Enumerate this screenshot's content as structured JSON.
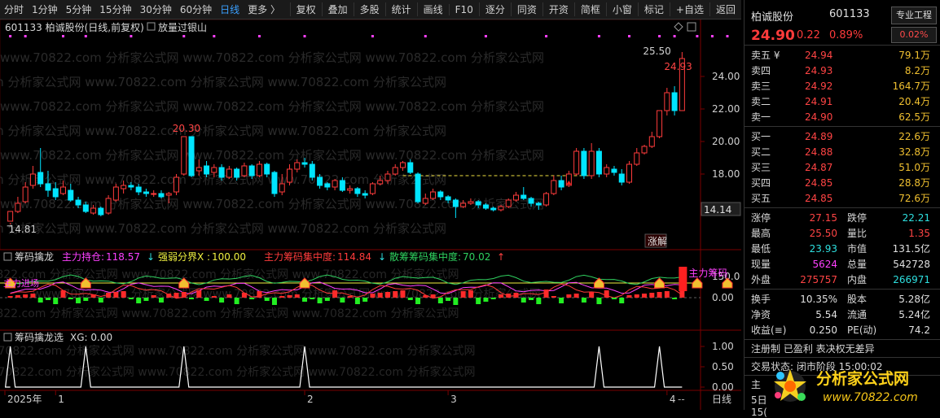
{
  "toolbar": {
    "left_items": [
      "分时",
      "1分钟",
      "5分钟",
      "15分钟",
      "30分钟",
      "60分钟",
      "日线",
      "更多 〉"
    ],
    "active": "日线",
    "right_items": [
      "复权",
      "叠加",
      "多股",
      "统计",
      "画线",
      "F10",
      "逐分",
      "同资",
      "开资",
      "简框",
      "小窗",
      "标记",
      "+自选",
      "返回"
    ]
  },
  "main_chart": {
    "title": "601133 柏诚股份(日线,前复权)",
    "indicator_label": "放量过银山",
    "watermark": "www.70822.com 分析家公式网",
    "y_axis": [
      "24.00",
      "22.00",
      "20.00",
      "18.00",
      "16.00"
    ],
    "y_ticks": [
      24,
      22,
      20,
      18,
      16
    ],
    "y_range": [
      13.6,
      26.4
    ],
    "annot_high": "20.30",
    "annot_low": "14.81",
    "annot_peak": "25.50",
    "annot_last": "24.93",
    "cursor_value": "14.14",
    "badge": "涨解",
    "up_color": "#ff3b3b",
    "down_color": "#00e5ff",
    "dashed_level": 17.9
  },
  "chart_data": [
    {
      "type": "candlestick",
      "title": "601133 柏诚股份(日线,前复权)",
      "candles": [
        [
          15.1,
          15.7,
          15.0,
          14.9
        ],
        [
          15.7,
          16.2,
          16.6,
          15.6
        ],
        [
          16.3,
          17.2,
          17.5,
          16.2
        ],
        [
          17.3,
          18.0,
          18.5,
          17.1
        ],
        [
          18.1,
          17.4,
          19.6,
          17.2
        ],
        [
          17.4,
          17.0,
          18.2,
          16.6
        ],
        [
          17.1,
          16.6,
          17.5,
          16.4
        ],
        [
          16.8,
          17.2,
          17.6,
          16.7
        ],
        [
          17.0,
          16.4,
          17.4,
          16.3
        ],
        [
          16.4,
          16.1,
          16.6,
          15.9
        ],
        [
          16.1,
          15.7,
          16.3,
          15.6
        ],
        [
          15.6,
          15.9,
          16.1,
          15.5
        ],
        [
          15.9,
          15.5,
          16.0,
          15.4
        ],
        [
          15.6,
          16.5,
          16.7,
          15.5
        ],
        [
          16.4,
          17.2,
          17.4,
          16.3
        ],
        [
          17.1,
          17.3,
          17.6,
          16.8
        ],
        [
          17.3,
          17.2,
          17.5,
          17.0
        ],
        [
          17.2,
          16.9,
          17.4,
          16.7
        ],
        [
          16.9,
          16.8,
          17.1,
          16.6
        ],
        [
          16.8,
          16.8,
          17.0,
          16.6
        ],
        [
          16.8,
          16.6,
          17.0,
          16.5
        ],
        [
          16.7,
          16.8,
          16.9,
          16.2
        ],
        [
          16.9,
          17.8,
          18.0,
          16.7
        ],
        [
          18.0,
          20.3,
          20.3,
          17.9
        ],
        [
          20.3,
          17.9,
          20.3,
          17.8
        ],
        [
          18.2,
          18.4,
          18.9,
          17.9
        ],
        [
          18.5,
          18.0,
          18.8,
          17.8
        ],
        [
          18.1,
          18.4,
          18.6,
          17.8
        ],
        [
          18.4,
          17.8,
          18.6,
          17.6
        ],
        [
          17.8,
          18.3,
          18.5,
          17.7
        ],
        [
          18.3,
          17.8,
          18.4,
          17.6
        ],
        [
          17.9,
          18.5,
          18.7,
          17.8
        ],
        [
          18.5,
          17.9,
          18.6,
          17.7
        ],
        [
          17.9,
          18.6,
          18.8,
          17.8
        ],
        [
          18.6,
          18.0,
          18.7,
          17.8
        ],
        [
          18.1,
          16.8,
          18.2,
          16.6
        ],
        [
          16.9,
          17.4,
          18.0,
          16.7
        ],
        [
          17.5,
          18.3,
          18.6,
          17.3
        ],
        [
          18.3,
          18.7,
          18.9,
          18.1
        ],
        [
          18.7,
          18.6,
          19.0,
          18.4
        ],
        [
          18.6,
          17.8,
          18.8,
          17.6
        ],
        [
          17.8,
          17.3,
          18.0,
          17.1
        ],
        [
          17.4,
          17.2,
          17.5,
          17.0
        ],
        [
          17.2,
          17.6,
          17.7,
          17.0
        ],
        [
          17.6,
          17.0,
          17.8,
          16.9
        ],
        [
          17.0,
          17.1,
          17.3,
          16.8
        ],
        [
          17.1,
          16.8,
          17.2,
          16.6
        ],
        [
          16.8,
          16.7,
          17.0,
          16.5
        ],
        [
          16.8,
          17.4,
          17.5,
          16.7
        ],
        [
          17.4,
          17.6,
          17.9,
          17.3
        ],
        [
          17.6,
          18.0,
          18.2,
          17.4
        ],
        [
          18.0,
          18.4,
          18.6,
          17.9
        ],
        [
          18.4,
          18.7,
          18.8,
          18.2
        ],
        [
          18.7,
          18.1,
          18.9,
          18.0
        ],
        [
          18.0,
          16.3,
          18.1,
          16.2
        ],
        [
          16.2,
          16.5,
          16.8,
          16.1
        ],
        [
          16.5,
          16.9,
          17.1,
          16.4
        ],
        [
          16.9,
          16.6,
          17.0,
          16.4
        ],
        [
          16.6,
          16.4,
          16.7,
          16.2
        ],
        [
          16.4,
          16.0,
          16.5,
          15.3
        ],
        [
          16.0,
          16.2,
          16.4,
          15.9
        ],
        [
          16.2,
          16.3,
          16.5,
          16.1
        ],
        [
          16.3,
          16.1,
          16.4,
          15.9
        ],
        [
          16.1,
          15.9,
          16.2,
          15.8
        ],
        [
          15.9,
          15.8,
          16.0,
          15.7
        ],
        [
          15.8,
          16.0,
          16.1,
          15.7
        ],
        [
          16.0,
          16.4,
          16.5,
          15.9
        ],
        [
          16.4,
          16.7,
          16.9,
          16.3
        ],
        [
          16.7,
          16.5,
          17.2,
          16.4
        ],
        [
          16.5,
          16.2,
          16.6,
          16.0
        ],
        [
          16.2,
          16.1,
          16.3,
          15.8
        ],
        [
          16.1,
          16.8,
          16.9,
          16.0
        ],
        [
          16.8,
          17.6,
          17.9,
          16.7
        ],
        [
          17.6,
          17.2,
          17.9,
          17.0
        ],
        [
          17.3,
          18.0,
          18.2,
          17.2
        ],
        [
          18.0,
          19.4,
          19.6,
          17.9
        ],
        [
          19.4,
          17.9,
          19.6,
          17.7
        ],
        [
          17.9,
          19.4,
          19.9,
          17.7
        ],
        [
          19.4,
          18.0,
          19.6,
          17.8
        ],
        [
          18.0,
          18.4,
          18.6,
          17.8
        ],
        [
          18.3,
          18.1,
          18.5,
          17.9
        ],
        [
          18.0,
          17.5,
          18.3,
          17.3
        ],
        [
          17.5,
          18.6,
          18.8,
          17.4
        ],
        [
          18.6,
          19.3,
          19.6,
          18.5
        ],
        [
          19.3,
          19.7,
          19.8,
          19.2
        ],
        [
          19.7,
          20.3,
          20.6,
          19.6
        ],
        [
          20.3,
          21.9,
          21.9,
          20.2
        ],
        [
          21.9,
          23.0,
          23.3,
          21.6
        ],
        [
          23.0,
          21.9,
          23.4,
          21.6
        ],
        [
          21.9,
          25.1,
          25.5,
          21.9
        ]
      ],
      "y_ticks": [
        24,
        22,
        20,
        18,
        16
      ]
    },
    {
      "type": "composite",
      "title": "筹码擒龙",
      "legend": [
        {
          "name": "主力持仓",
          "value": "118.57",
          "arrow": "↓",
          "color": "#ff40ff"
        },
        {
          "name": "强弱分界X",
          "value": "100.00",
          "arrow": "",
          "color": "#f0f040"
        },
        {
          "name": "主力筹码集中度",
          "value": "114.84",
          "arrow": "↓",
          "color": "#ff3b3b"
        },
        {
          "name": "散筹筹码集中度",
          "value": "70.02",
          "arrow": "↑",
          "color": "#2fd05f"
        }
      ],
      "y_axis": [
        "150.0",
        "0.00"
      ],
      "label_right": "主力筹码",
      "label_left": "主力进场"
    },
    {
      "type": "line",
      "title": "筹码擒龙选",
      "legend": "XG: 0.00",
      "y_axis": [
        "1.00",
        "0.50",
        "0.00"
      ],
      "spikes_at": [
        0,
        10,
        23,
        39,
        78,
        86,
        91,
        95
      ],
      "x_labels": [
        {
          "label": "2025年",
          "idx": 0
        },
        {
          "label": "1",
          "idx": 6
        },
        {
          "label": "2",
          "idx": 39
        },
        {
          "label": "3",
          "idx": 58
        },
        {
          "label": "4",
          "idx": 87
        }
      ],
      "axis_right": "日线",
      "dash_right": "--"
    }
  ],
  "quote": {
    "name": "柏诚股份",
    "code": "601133",
    "small_mark": "R",
    "price": "24.90",
    "change": "0.22",
    "change_pct": "0.89%",
    "btn_project": "专业工程",
    "btn_pct": "0.02%",
    "sell": [
      {
        "label": "卖五 ¥",
        "price": "24.94",
        "vol": "79.1万"
      },
      {
        "label": "卖四",
        "price": "24.93",
        "vol": "8.2万"
      },
      {
        "label": "卖三",
        "price": "24.92",
        "vol": "164.7万"
      },
      {
        "label": "卖二",
        "price": "24.91",
        "vol": "20.4万"
      },
      {
        "label": "卖一",
        "price": "24.90",
        "vol": "62.5万"
      }
    ],
    "buy": [
      {
        "label": "买一",
        "price": "24.89",
        "vol": "22.6万"
      },
      {
        "label": "买二",
        "price": "24.88",
        "vol": "32.8万"
      },
      {
        "label": "买三",
        "price": "24.87",
        "vol": "51.0万"
      },
      {
        "label": "买四",
        "price": "24.85",
        "vol": "28.8万"
      },
      {
        "label": "买五",
        "price": "24.85",
        "vol": "72.6万"
      }
    ],
    "stats1": [
      {
        "k1": "涨停",
        "v1": "27.15",
        "c1": "red",
        "k2": "跌停",
        "v2": "22.21",
        "c2": "cyn"
      },
      {
        "k1": "最高",
        "v1": "25.50",
        "c1": "red",
        "k2": "量比",
        "v2": "1.35",
        "c2": "red"
      },
      {
        "k1": "最低",
        "v1": "23.93",
        "c1": "cyn",
        "k2": "市值",
        "v2": "131.5亿",
        "c2": "wht"
      },
      {
        "k1": "现量",
        "v1": "5624",
        "c1": "mag",
        "k2": "总量",
        "v2": "542728",
        "c2": "wht"
      },
      {
        "k1": "外盘",
        "v1": "275757",
        "c1": "red",
        "k2": "内盘",
        "v2": "266971",
        "c2": "cyn"
      }
    ],
    "stats2": [
      {
        "k1": "换手",
        "v1": "10.35%",
        "c1": "wht",
        "k2": "股本",
        "v2": "5.28亿",
        "c2": "wht"
      },
      {
        "k1": "净资",
        "v1": "5.54",
        "c1": "wht",
        "k2": "流通",
        "v2": "5.24亿",
        "c2": "wht"
      },
      {
        "k1": "收益(≡)",
        "v1": "0.250",
        "c1": "wht",
        "k2": "PE(动)",
        "v2": "74.2",
        "c2": "wht"
      }
    ],
    "note1": "注册制 已盈利 表决权无差异",
    "note2": "交易状态: 闭市阶段 15:00:02",
    "note3": "主",
    "note4": "5日",
    "note5": "15(",
    "logo_text": "分析家公式网",
    "logo_url": "www.70822.com"
  }
}
